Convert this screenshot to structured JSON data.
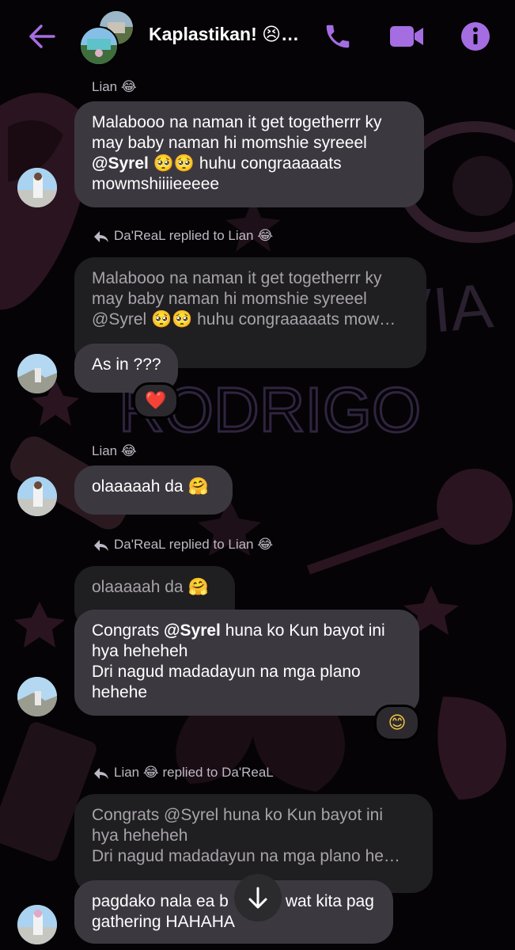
{
  "header": {
    "title": "Kaplastikan! 😣…",
    "colors": {
      "accent": "#a56de2",
      "background": "#000000"
    },
    "icons": [
      "back-arrow-icon",
      "phone-icon",
      "video-camera-icon",
      "info-icon"
    ]
  },
  "messages": {
    "m1": {
      "sender": "Lian 😂",
      "text": {
        "l1": "Malabooo na naman it get togetherrr ky",
        "l2": "may baby naman hi momshie syreeel",
        "mention": "@Syrel",
        "l3_rest": " 🥺🥺 huhu congraaaaats",
        "l4": "mowmshiiiieeeee"
      }
    },
    "m2": {
      "reply_to": "Da'ReaL replied to Lian 😂",
      "quoted": {
        "l1": "Malabooo na naman it get togetherrr ky",
        "l2": "may baby naman hi momshie syreeel",
        "l3": "@Syrel 🥺🥺 huhu congraaaaats mow…"
      },
      "text": "As in ???",
      "reaction": "❤️"
    },
    "m3": {
      "sender": "Lian 😂",
      "text": "olaaaaah da 🤗"
    },
    "m4": {
      "reply_to": "Da'ReaL replied to Lian 😂",
      "quoted": "olaaaaah da 🤗",
      "text": {
        "l1_prefix": "Congrats ",
        "mention": "@Syrel",
        "l1_suffix": " huna ko Kun bayot ini",
        "l2": "hya heheheh",
        "l3": "Dri nagud madadayun na mga plano",
        "l4": "hehehe"
      },
      "reaction": "😊"
    },
    "m5": {
      "reply_to": "Lian 😂 replied to Da'ReaL",
      "quoted": {
        "l1": "Congrats @Syrel huna ko Kun bayot ini",
        "l2": "hya heheheh",
        "l3": "Dri nagud madadayun na mga plano he…"
      },
      "text": {
        "l1": "pagdako nala ea b",
        "l1b": "wat kita pag",
        "l2": "gathering HAHAHA"
      }
    }
  }
}
